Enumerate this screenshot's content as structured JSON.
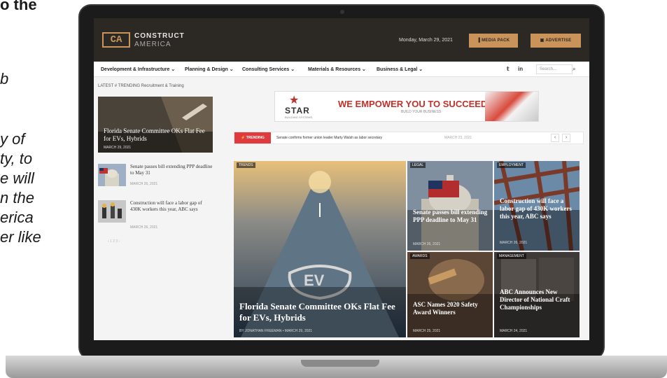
{
  "left_text": {
    "top": "o the",
    "lines": [
      "b",
      "y of",
      "ty, to",
      "e will",
      "n the",
      "erica",
      "er like"
    ]
  },
  "site": {
    "logo_mark": "CA",
    "logo_line1": "CONSTRUCT",
    "logo_line2": "AMERICA",
    "date": "Monday, March 29, 2021",
    "media_pack": "MEDIA PACK",
    "advertise": "ADVERTISE"
  },
  "nav": {
    "items": [
      "Development & Infrastructure ⌄",
      "Planning & Design ⌄",
      "Consulting Services ⌄",
      "Materials & Resources ⌄",
      "Business & Legal ⌄"
    ],
    "search_placeholder": "Search..."
  },
  "sidebar": {
    "label": "LATEST # TRENDING Recruitment & Training",
    "feature": {
      "title": "Florida Senate Committee OKs Flat Fee for EVs, Hybrids",
      "date": "MARCH 29, 2021"
    },
    "items": [
      {
        "title": "Senate passes bill extending PPP deadline to May 31",
        "date": "MARCH 26, 2021"
      },
      {
        "title": "Construction will face a labor gap of 430K workers this year, ABC says",
        "date": "MARCH 26, 2021"
      }
    ],
    "pager": "‹ 1 2 3 ›"
  },
  "ad": {
    "brand": "STAR",
    "brand_sub": "BUILDING SYSTEMS",
    "tagline": "WE EMPOWER YOU TO SUCCEED.",
    "sub": "BUILD YOUR BUSINESS"
  },
  "trending": {
    "badge": "⚡ TRENDING",
    "text": "Senate confirms former union leader Marty Walsh as labor secretary",
    "date": "MARCH 23, 2021",
    "prev": "‹",
    "next": "›"
  },
  "tiles": [
    {
      "badge": "TRENDS",
      "title": "Florida Senate Committee OKs Flat Fee for EVs, Hybrids",
      "meta": "BY JONATHAN FREEMAN • MARCH 29, 2021"
    },
    {
      "badge": "LEGAL",
      "title": "Senate passes bill extending PPP deadline to May 31",
      "meta": "MARCH 26, 2021"
    },
    {
      "badge": "EMPLOYMENT",
      "title": "Construction will face a labor gap of 430K workers this year, ABC says",
      "meta": "MARCH 26, 2021"
    },
    {
      "badge": "AWARDS",
      "title": "ASC Names 2020 Safety Award Winners",
      "meta": "MARCH 25, 2021"
    },
    {
      "badge": "MANAGEMENT",
      "title": "ABC Announces New Director of National Craft Championships",
      "meta": "MARCH 24, 2021"
    }
  ],
  "colors": {
    "header_bg": "#2c2924",
    "accent_gold": "#c9935a",
    "trending_red": "#e03a3e"
  }
}
